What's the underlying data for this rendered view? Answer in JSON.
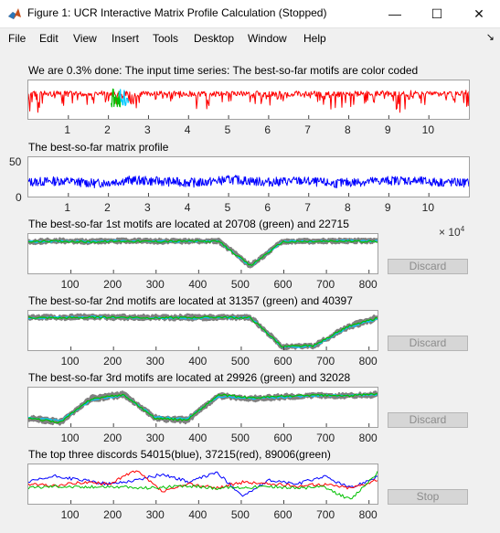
{
  "window": {
    "title": "Figure 1: UCR Interactive Matrix Profile Calculation (Stopped)",
    "minimize_glyph": "—",
    "maximize_glyph": "☐",
    "close_glyph": "✕",
    "dock_glyph": "↘",
    "icon": "matlab-icon"
  },
  "menu": [
    "File",
    "Edit",
    "View",
    "Insert",
    "Tools",
    "Desktop",
    "Window",
    "Help"
  ],
  "panels": {
    "p1_title": "We are 0.3% done: The input time series: The best-so-far motifs are color coded",
    "p2_title": "The best-so-far matrix profile",
    "p3_title": "The best-so-far 1st motifs are located at 20708 (green) and 22715",
    "p4_title": "The best-so-far 2nd motifs are located at 31357 (green) and 40397",
    "p5_title": "The best-so-far 3rd motifs are located at 29926 (green) and 32028",
    "p6_title": "The top three discords 54015(blue), 37215(red), 89006(green)"
  },
  "exponent": {
    "base": "× 10",
    "power": "4"
  },
  "buttons": {
    "discard1": "Discard",
    "discard2": "Discard",
    "discard3": "Discard",
    "stop": "Stop"
  },
  "ticks": {
    "series_x": [
      "1",
      "2",
      "3",
      "4",
      "5",
      "6",
      "7",
      "8",
      "9",
      "10"
    ],
    "mp_y": [
      "50",
      "0"
    ],
    "motif_x": [
      "100",
      "200",
      "300",
      "400",
      "500",
      "600",
      "700",
      "800"
    ]
  },
  "colors": {
    "series": "#ff0000",
    "profile": "#0000ff",
    "gray": "#808080",
    "green": "#00c000",
    "cyan": "#00c8ff",
    "blue": "#0000ff",
    "red": "#ff0000"
  },
  "chart_data": [
    {
      "type": "line",
      "title": "We are 0.3% done: The input time series: The best-so-far motifs are color coded",
      "xlim": [
        0,
        110000
      ],
      "x_ticks": [
        10000,
        20000,
        30000,
        40000,
        50000,
        60000,
        70000,
        80000,
        90000,
        100000
      ],
      "x_tick_labels": [
        "1",
        "2",
        "3",
        "4",
        "5",
        "6",
        "7",
        "8",
        "9",
        "10"
      ],
      "x_exponent": "× 10^4",
      "series": [
        {
          "values": [
            0.9,
            0.7,
            0.5,
            0.9,
            0.3,
            0.9,
            0.4,
            0.7,
            0.2,
            0.8,
            0.6,
            0.9,
            0.4,
            0.8
          ]
        }
      ],
      "highlights": [
        {
          "color": "green",
          "x": 20708
        },
        {
          "color": "cyan",
          "x": 22715
        }
      ]
    },
    {
      "type": "line",
      "title": "The best-so-far matrix profile",
      "xlim": [
        0,
        110000
      ],
      "ylim": [
        0,
        60
      ],
      "y_ticks": [
        0,
        50
      ],
      "x_ticks": [
        10000,
        20000,
        30000,
        40000,
        50000,
        60000,
        70000,
        80000,
        90000,
        100000
      ],
      "x_tick_labels": [
        "1",
        "2",
        "3",
        "4",
        "5",
        "6",
        "7",
        "8",
        "9",
        "10"
      ],
      "series": [
        {
          "values": [
            22,
            24,
            20,
            25,
            23,
            21,
            26,
            22,
            24,
            20,
            23,
            25,
            22,
            21
          ]
        }
      ]
    },
    {
      "type": "line",
      "title": "The best-so-far 1st motifs are located at 20708 (green) and 22715",
      "xlim": [
        0,
        820
      ],
      "x_ticks": [
        100,
        200,
        300,
        400,
        500,
        600,
        700,
        800
      ],
      "series": [
        {
          "values": [
            0.82,
            0.83,
            0.82,
            0.84,
            0.83,
            0.82,
            0.83,
            0.2,
            0.82,
            0.83,
            0.82,
            0.83
          ]
        },
        {
          "values": [
            0.8,
            0.82,
            0.81,
            0.83,
            0.82,
            0.81,
            0.82,
            0.18,
            0.81,
            0.82,
            0.83,
            0.82
          ]
        },
        {
          "values": [
            0.81,
            0.82,
            0.8,
            0.82,
            0.81,
            0.82,
            0.81,
            0.19,
            0.8,
            0.81,
            0.82,
            0.81
          ]
        }
      ]
    },
    {
      "type": "line",
      "title": "The best-so-far 2nd motifs are located at 31357 (green) and 40397",
      "xlim": [
        0,
        820
      ],
      "x_ticks": [
        100,
        200,
        300,
        400,
        500,
        600,
        700,
        800
      ],
      "series": [
        {
          "values": [
            0.85,
            0.84,
            0.86,
            0.85,
            0.84,
            0.85,
            0.84,
            0.85,
            0.1,
            0.12,
            0.6,
            0.85
          ]
        },
        {
          "values": [
            0.82,
            0.83,
            0.84,
            0.82,
            0.83,
            0.81,
            0.82,
            0.83,
            0.08,
            0.1,
            0.55,
            0.8
          ]
        },
        {
          "values": [
            0.83,
            0.82,
            0.83,
            0.84,
            0.82,
            0.83,
            0.84,
            0.82,
            0.09,
            0.11,
            0.58,
            0.82
          ]
        }
      ]
    },
    {
      "type": "line",
      "title": "The best-so-far 3rd motifs are located at 29926 (green) and 32028",
      "xlim": [
        0,
        820
      ],
      "x_ticks": [
        100,
        200,
        300,
        400,
        500,
        600,
        700,
        800
      ],
      "series": [
        {
          "values": [
            0.2,
            0.1,
            0.75,
            0.85,
            0.2,
            0.15,
            0.8,
            0.7,
            0.75,
            0.8,
            0.78,
            0.8
          ]
        },
        {
          "values": [
            0.25,
            0.15,
            0.7,
            0.8,
            0.25,
            0.2,
            0.78,
            0.72,
            0.76,
            0.79,
            0.8,
            0.82
          ]
        },
        {
          "values": [
            0.22,
            0.12,
            0.72,
            0.82,
            0.22,
            0.18,
            0.82,
            0.74,
            0.78,
            0.81,
            0.79,
            0.84
          ]
        }
      ]
    },
    {
      "type": "line",
      "title": "The top three discords 54015(blue), 37215(red), 89006(green)",
      "xlim": [
        0,
        820
      ],
      "x_ticks": [
        100,
        200,
        300,
        400,
        500,
        600,
        700,
        800
      ],
      "series": [
        {
          "name": "blue",
          "values": [
            0.55,
            0.7,
            0.6,
            0.5,
            0.6,
            0.75,
            0.55,
            0.8,
            0.2,
            0.6,
            0.5,
            0.7,
            0.4,
            0.7
          ]
        },
        {
          "name": "red",
          "values": [
            0.5,
            0.45,
            0.55,
            0.5,
            0.85,
            0.3,
            0.5,
            0.4,
            0.55,
            0.5,
            0.45,
            0.5,
            0.4,
            0.6
          ]
        },
        {
          "name": "green",
          "values": [
            0.4,
            0.45,
            0.42,
            0.44,
            0.4,
            0.42,
            0.45,
            0.4,
            0.42,
            0.44,
            0.4,
            0.42,
            0.1,
            0.8
          ]
        }
      ]
    }
  ]
}
